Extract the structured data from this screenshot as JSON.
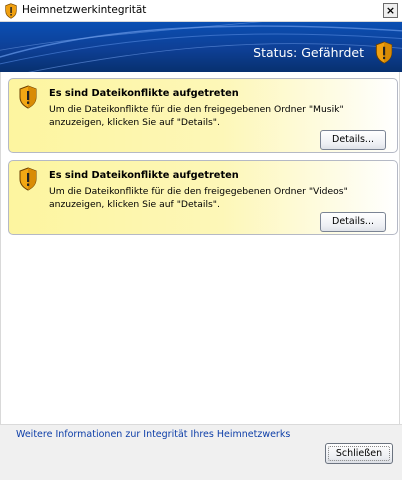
{
  "window": {
    "title": "Heimnetzwerkintegrität",
    "close_glyph": "×"
  },
  "banner": {
    "status": "Status: Gefährdet",
    "icon": "shield-warning-icon"
  },
  "cards": [
    {
      "title": "Es sind Dateikonflikte aufgetreten",
      "text": "Um die Dateikonflikte für die den freigegebenen Ordner \"Musik\" anzuzeigen, klicken Sie auf \"Details\".",
      "button": "Details..."
    },
    {
      "title": "Es sind Dateikonflikte aufgetreten",
      "text": "Um die Dateikonflikte für die den freigegebenen Ordner \"Videos\" anzuzeigen, klicken Sie auf \"Details\".",
      "button": "Details..."
    }
  ],
  "footer": {
    "more_link": "Weitere Informationen zur Integrität Ihres Heimnetzwerks",
    "close_button": "Schließen"
  },
  "colors": {
    "banner": "#0e3f95",
    "card": "#fdf59f",
    "shield": "#f0a010",
    "link": "#0d3ea8"
  }
}
